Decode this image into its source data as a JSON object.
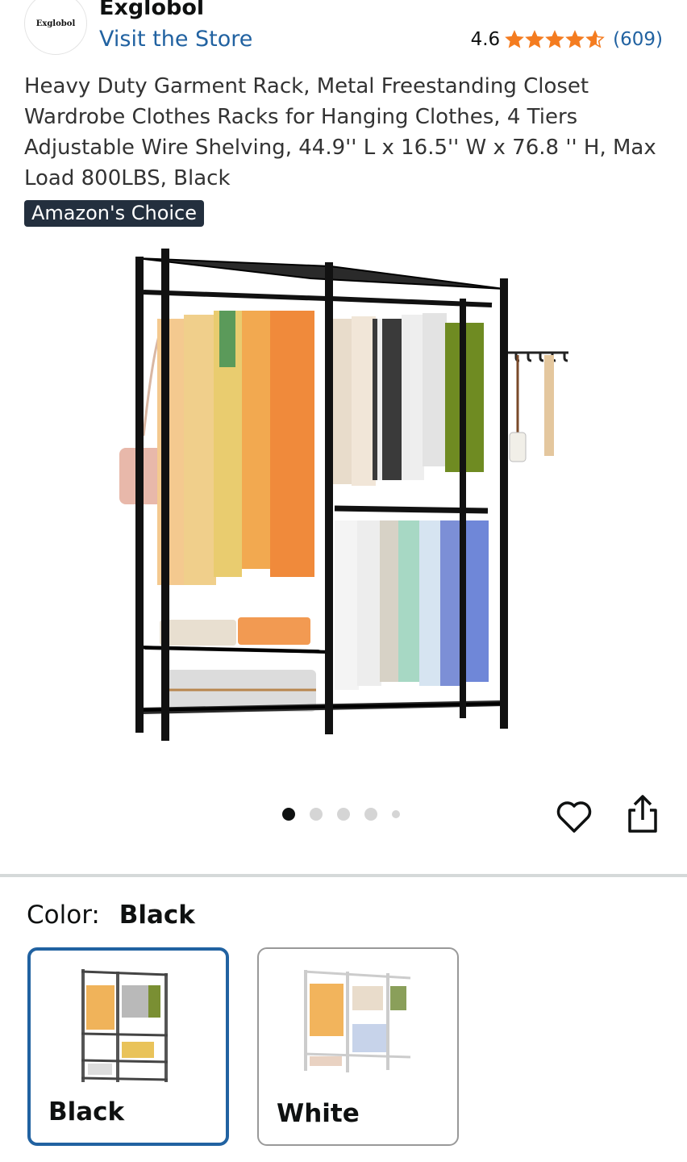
{
  "store": {
    "logo_text": "Exglobol",
    "brand_name": "Exglobol",
    "visit_link": "Visit the Store"
  },
  "rating": {
    "value": "4.6",
    "stars": 4.6,
    "count": "(609)",
    "star_color": "#f47c20"
  },
  "product": {
    "title": "Heavy Duty Garment Rack, Metal Freestanding Closet Wardrobe Clothes Racks for Hanging Clothes, 4 Tiers Adjustable Wire Shelving, 44.9'' L x 16.5'' W x 76.8 '' H, Max Load 800LBS, Black",
    "badge": "Amazon's Choice",
    "image_icon": "garment-rack-product-image"
  },
  "carousel": {
    "total_dots": 5,
    "active_index": 0
  },
  "actions": {
    "wishlist_icon": "heart-icon",
    "share_icon": "share-icon"
  },
  "variation": {
    "label": "Color:",
    "selected": "Black",
    "options": [
      {
        "name": "Black",
        "selected": true
      },
      {
        "name": "White",
        "selected": false
      }
    ]
  },
  "colors": {
    "link": "#2162a1",
    "badge_bg": "#232f3e",
    "selected_border": "#2162a1"
  }
}
